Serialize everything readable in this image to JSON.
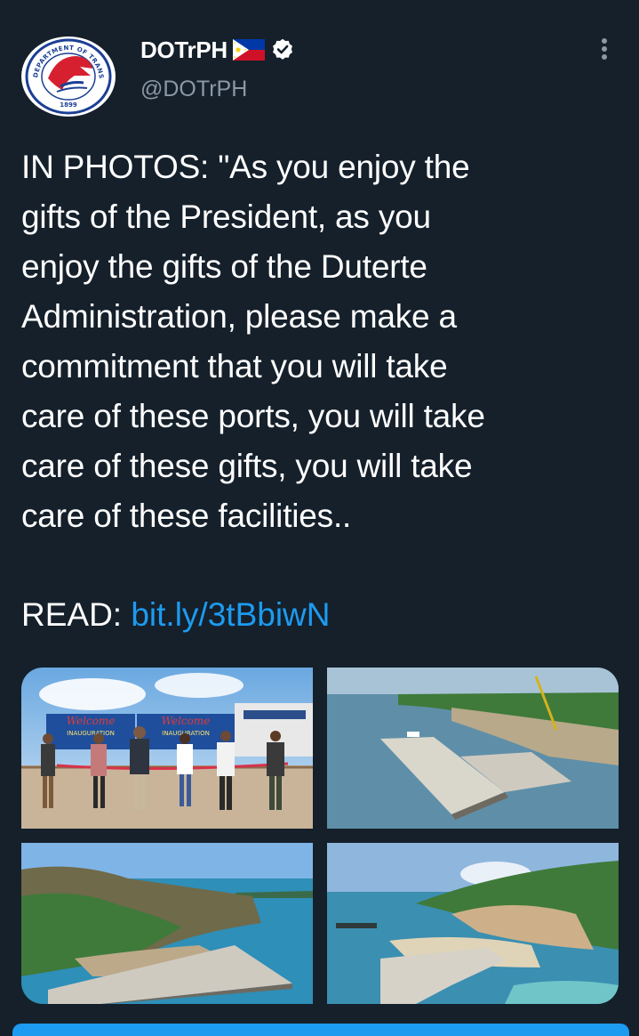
{
  "tweet": {
    "display_name": "DOTrPH",
    "handle": "@DOTrPH",
    "text": "IN PHOTOS: \"As you enjoy the\ngifts of the President, as you\nenjoy the gifts of the Duterte\nAdministration, please make a\ncommitment that you will take\ncare of these ports, you will take\ncare of these gifts, you will take\ncare of these facilities..",
    "read_label": "READ: ",
    "link": "bit.ly/3tBbiwN"
  },
  "avatar": {
    "ring_text": "DEPARTMENT OF TRANSPORTATION",
    "year": "1899"
  },
  "icons": {
    "flag": "philippines-flag-icon",
    "verified": "verified-badge-icon",
    "more": "more-vertical-icon"
  },
  "photos": {
    "p1": {
      "banner_left": "Welcome",
      "banner_right": "Welcome",
      "sub_left": "INAUGURATION",
      "sub_right": "INAUGURATION"
    }
  },
  "colors": {
    "background": "#15202b",
    "text": "#ffffff",
    "secondary": "#8b98a5",
    "link": "#1d9bf0",
    "logo_red": "#d6202f",
    "logo_blue": "#1c3f94"
  }
}
